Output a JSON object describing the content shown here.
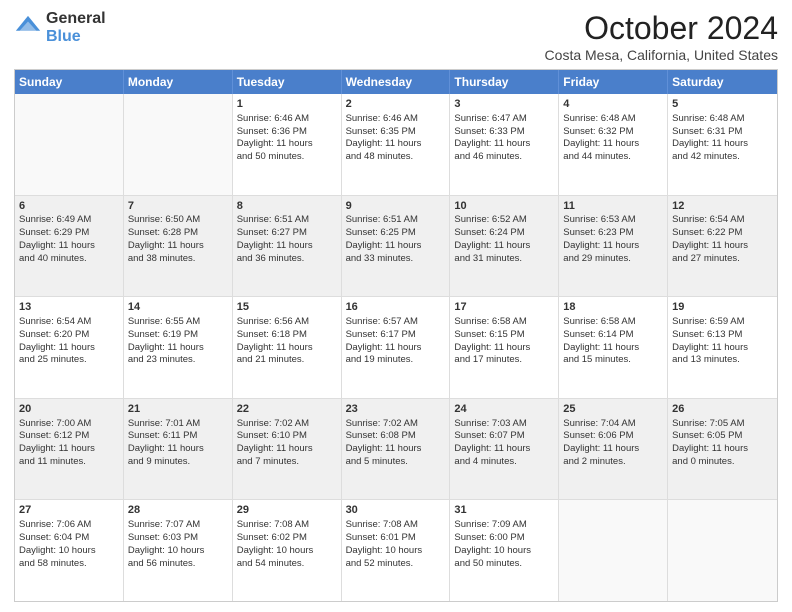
{
  "logo": {
    "general": "General",
    "blue": "Blue"
  },
  "title": "October 2024",
  "subtitle": "Costa Mesa, California, United States",
  "days": [
    "Sunday",
    "Monday",
    "Tuesday",
    "Wednesday",
    "Thursday",
    "Friday",
    "Saturday"
  ],
  "rows": [
    [
      {
        "day": "",
        "empty": true
      },
      {
        "day": "",
        "empty": true
      },
      {
        "day": "1",
        "lines": [
          "Sunrise: 6:46 AM",
          "Sunset: 6:36 PM",
          "Daylight: 11 hours",
          "and 50 minutes."
        ]
      },
      {
        "day": "2",
        "lines": [
          "Sunrise: 6:46 AM",
          "Sunset: 6:35 PM",
          "Daylight: 11 hours",
          "and 48 minutes."
        ]
      },
      {
        "day": "3",
        "lines": [
          "Sunrise: 6:47 AM",
          "Sunset: 6:33 PM",
          "Daylight: 11 hours",
          "and 46 minutes."
        ]
      },
      {
        "day": "4",
        "lines": [
          "Sunrise: 6:48 AM",
          "Sunset: 6:32 PM",
          "Daylight: 11 hours",
          "and 44 minutes."
        ]
      },
      {
        "day": "5",
        "lines": [
          "Sunrise: 6:48 AM",
          "Sunset: 6:31 PM",
          "Daylight: 11 hours",
          "and 42 minutes."
        ]
      }
    ],
    [
      {
        "day": "6",
        "shaded": true,
        "lines": [
          "Sunrise: 6:49 AM",
          "Sunset: 6:29 PM",
          "Daylight: 11 hours",
          "and 40 minutes."
        ]
      },
      {
        "day": "7",
        "shaded": true,
        "lines": [
          "Sunrise: 6:50 AM",
          "Sunset: 6:28 PM",
          "Daylight: 11 hours",
          "and 38 minutes."
        ]
      },
      {
        "day": "8",
        "shaded": true,
        "lines": [
          "Sunrise: 6:51 AM",
          "Sunset: 6:27 PM",
          "Daylight: 11 hours",
          "and 36 minutes."
        ]
      },
      {
        "day": "9",
        "shaded": true,
        "lines": [
          "Sunrise: 6:51 AM",
          "Sunset: 6:25 PM",
          "Daylight: 11 hours",
          "and 33 minutes."
        ]
      },
      {
        "day": "10",
        "shaded": true,
        "lines": [
          "Sunrise: 6:52 AM",
          "Sunset: 6:24 PM",
          "Daylight: 11 hours",
          "and 31 minutes."
        ]
      },
      {
        "day": "11",
        "shaded": true,
        "lines": [
          "Sunrise: 6:53 AM",
          "Sunset: 6:23 PM",
          "Daylight: 11 hours",
          "and 29 minutes."
        ]
      },
      {
        "day": "12",
        "shaded": true,
        "lines": [
          "Sunrise: 6:54 AM",
          "Sunset: 6:22 PM",
          "Daylight: 11 hours",
          "and 27 minutes."
        ]
      }
    ],
    [
      {
        "day": "13",
        "lines": [
          "Sunrise: 6:54 AM",
          "Sunset: 6:20 PM",
          "Daylight: 11 hours",
          "and 25 minutes."
        ]
      },
      {
        "day": "14",
        "lines": [
          "Sunrise: 6:55 AM",
          "Sunset: 6:19 PM",
          "Daylight: 11 hours",
          "and 23 minutes."
        ]
      },
      {
        "day": "15",
        "lines": [
          "Sunrise: 6:56 AM",
          "Sunset: 6:18 PM",
          "Daylight: 11 hours",
          "and 21 minutes."
        ]
      },
      {
        "day": "16",
        "lines": [
          "Sunrise: 6:57 AM",
          "Sunset: 6:17 PM",
          "Daylight: 11 hours",
          "and 19 minutes."
        ]
      },
      {
        "day": "17",
        "lines": [
          "Sunrise: 6:58 AM",
          "Sunset: 6:15 PM",
          "Daylight: 11 hours",
          "and 17 minutes."
        ]
      },
      {
        "day": "18",
        "lines": [
          "Sunrise: 6:58 AM",
          "Sunset: 6:14 PM",
          "Daylight: 11 hours",
          "and 15 minutes."
        ]
      },
      {
        "day": "19",
        "lines": [
          "Sunrise: 6:59 AM",
          "Sunset: 6:13 PM",
          "Daylight: 11 hours",
          "and 13 minutes."
        ]
      }
    ],
    [
      {
        "day": "20",
        "shaded": true,
        "lines": [
          "Sunrise: 7:00 AM",
          "Sunset: 6:12 PM",
          "Daylight: 11 hours",
          "and 11 minutes."
        ]
      },
      {
        "day": "21",
        "shaded": true,
        "lines": [
          "Sunrise: 7:01 AM",
          "Sunset: 6:11 PM",
          "Daylight: 11 hours",
          "and 9 minutes."
        ]
      },
      {
        "day": "22",
        "shaded": true,
        "lines": [
          "Sunrise: 7:02 AM",
          "Sunset: 6:10 PM",
          "Daylight: 11 hours",
          "and 7 minutes."
        ]
      },
      {
        "day": "23",
        "shaded": true,
        "lines": [
          "Sunrise: 7:02 AM",
          "Sunset: 6:08 PM",
          "Daylight: 11 hours",
          "and 5 minutes."
        ]
      },
      {
        "day": "24",
        "shaded": true,
        "lines": [
          "Sunrise: 7:03 AM",
          "Sunset: 6:07 PM",
          "Daylight: 11 hours",
          "and 4 minutes."
        ]
      },
      {
        "day": "25",
        "shaded": true,
        "lines": [
          "Sunrise: 7:04 AM",
          "Sunset: 6:06 PM",
          "Daylight: 11 hours",
          "and 2 minutes."
        ]
      },
      {
        "day": "26",
        "shaded": true,
        "lines": [
          "Sunrise: 7:05 AM",
          "Sunset: 6:05 PM",
          "Daylight: 11 hours",
          "and 0 minutes."
        ]
      }
    ],
    [
      {
        "day": "27",
        "lines": [
          "Sunrise: 7:06 AM",
          "Sunset: 6:04 PM",
          "Daylight: 10 hours",
          "and 58 minutes."
        ]
      },
      {
        "day": "28",
        "lines": [
          "Sunrise: 7:07 AM",
          "Sunset: 6:03 PM",
          "Daylight: 10 hours",
          "and 56 minutes."
        ]
      },
      {
        "day": "29",
        "lines": [
          "Sunrise: 7:08 AM",
          "Sunset: 6:02 PM",
          "Daylight: 10 hours",
          "and 54 minutes."
        ]
      },
      {
        "day": "30",
        "lines": [
          "Sunrise: 7:08 AM",
          "Sunset: 6:01 PM",
          "Daylight: 10 hours",
          "and 52 minutes."
        ]
      },
      {
        "day": "31",
        "lines": [
          "Sunrise: 7:09 AM",
          "Sunset: 6:00 PM",
          "Daylight: 10 hours",
          "and 50 minutes."
        ]
      },
      {
        "day": "",
        "empty": true
      },
      {
        "day": "",
        "empty": true
      }
    ]
  ]
}
